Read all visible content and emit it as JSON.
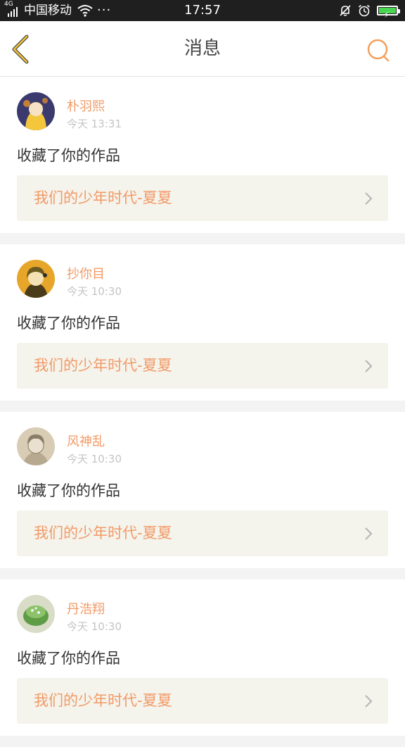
{
  "status_bar": {
    "network": "4G",
    "carrier": "中国移动",
    "dots": "···",
    "time": "17:57",
    "battery_color": "#48d651"
  },
  "header": {
    "title": "消息",
    "back_icon": "chevron-left-icon",
    "search_icon": "search-icon",
    "accent_color": "#f3a15f"
  },
  "messages": [
    {
      "username": "朴羽熙",
      "time": "今天 13:31",
      "action": "收藏了你的作品",
      "work_title": "我们的少年时代-夏夏",
      "avatar": {
        "bg": "#3a3a6e",
        "fg": "#f3c63c",
        "accent": "#e8922a"
      }
    },
    {
      "username": "抄你目",
      "time": "今天 10:30",
      "action": "收藏了你的作品",
      "work_title": "我们的少年时代-夏夏",
      "avatar": {
        "bg": "#e7a529",
        "fg": "#6b5a1e",
        "accent": "#f4e1b4"
      }
    },
    {
      "username": "风神乱",
      "time": "今天 10:30",
      "action": "收藏了你的作品",
      "work_title": "我们的少年时代-夏夏",
      "avatar": {
        "bg": "#d8ccb4",
        "fg": "#8a7c66",
        "accent": "#b7a98f"
      }
    },
    {
      "username": "丹浩翔",
      "time": "今天 10:30",
      "action": "收藏了你的作品",
      "work_title": "我们的少年时代-夏夏",
      "avatar": {
        "bg": "#d9dcc7",
        "fg": "#5f9c46",
        "accent": "#f2f2f2"
      }
    }
  ],
  "colors": {
    "username": "#f29a66",
    "work_title": "#f29a66",
    "link_bg": "#f4f3ec",
    "separator": "#f3f3f3"
  }
}
